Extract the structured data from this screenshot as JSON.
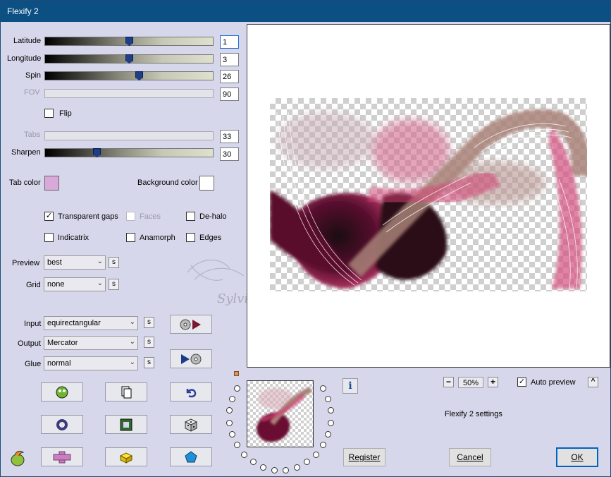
{
  "window": {
    "title": "Flexify 2"
  },
  "sliders": [
    {
      "label": "Latitude",
      "value": "1",
      "level": 0.5,
      "enabled": true
    },
    {
      "label": "Longitude",
      "value": "3",
      "level": 0.5,
      "enabled": true
    },
    {
      "label": "Spin",
      "value": "26",
      "level": 0.56,
      "enabled": true
    },
    {
      "label": "FOV",
      "value": "90",
      "enabled": false
    },
    {
      "label": "Tabs",
      "value": "33",
      "enabled": false
    },
    {
      "label": "Sharpen",
      "value": "30",
      "level": 0.3,
      "enabled": true
    }
  ],
  "flip": {
    "label": "Flip",
    "checked": false
  },
  "colors": {
    "tab_label": "Tab color",
    "tab_value": "#d9a9d9",
    "background_label": "Background color",
    "background_value": "#ffffff"
  },
  "options": {
    "transparent_gaps": {
      "label": "Transparent gaps",
      "checked": true
    },
    "faces": {
      "label": "Faces",
      "checked": false
    },
    "dehalo": {
      "label": "De-halo",
      "checked": false
    },
    "indicatrix": {
      "label": "Indicatrix",
      "checked": false
    },
    "anamorph": {
      "label": "Anamorph",
      "checked": false
    },
    "edges": {
      "label": "Edges",
      "checked": false
    }
  },
  "preview_mode": {
    "label": "Preview",
    "value": "best"
  },
  "grid": {
    "label": "Grid",
    "value": "none"
  },
  "s_label": "s",
  "projection": {
    "input_label": "Input",
    "input_value": "equirectangular",
    "output_label": "Output",
    "output_value": "Mercator",
    "glue_label": "Glue",
    "glue_value": "normal"
  },
  "zoom": {
    "minus": "−",
    "value": "50%",
    "plus": "+"
  },
  "auto_preview": {
    "label": "Auto preview",
    "checked": true,
    "collapse": "^"
  },
  "settings_name": "Flexify 2 settings",
  "info_label": "i",
  "watermark": "Sylviane",
  "buttons": {
    "register": "Register",
    "cancel": "Cancel",
    "ok": "OK"
  }
}
